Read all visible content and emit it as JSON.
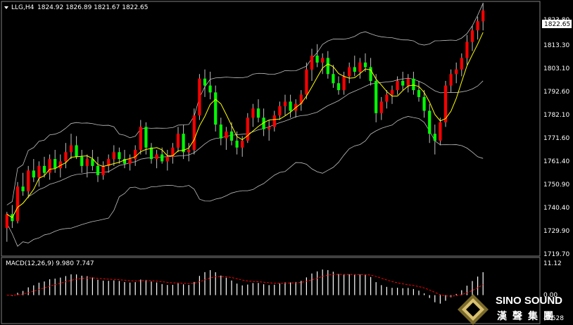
{
  "main_header": {
    "symbol": "LLG,H4",
    "ohlc": "1824.92 1826.89 1821.67 1822.65"
  },
  "macd_header": {
    "label": "MACD(12,26,9) 9.980 7.747"
  },
  "price_axis": {
    "ticks": [
      "1813.30",
      "1803.10",
      "1792.60",
      "1782.10",
      "1771.60",
      "1761.40",
      "1750.90",
      "1740.40",
      "1729.90",
      "1719.70"
    ],
    "current_price": "1822.65",
    "top_partial": "1823.80"
  },
  "macd_axis": {
    "ticks": [
      "11.12",
      "0.00",
      "-8.528"
    ]
  },
  "brand": {
    "name": "SINO SOUND",
    "chinese": "漢聲集團"
  },
  "colors": {
    "up": "#ffffff",
    "down": "#ff0000",
    "up_candle": "#00ff00",
    "ma_fast": "#ffff00",
    "bands": "#bfbfbf",
    "signal": "#ff0000",
    "histogram": "#ffffff"
  },
  "chart_data": {
    "type": "candlestick",
    "ylim": [
      1717,
      1826
    ],
    "candles": [
      [
        1728,
        1735,
        1722,
        1734
      ],
      [
        1734,
        1738,
        1728,
        1731
      ],
      [
        1731,
        1748,
        1730,
        1746
      ],
      [
        1746,
        1752,
        1742,
        1744
      ],
      [
        1744,
        1755,
        1741,
        1753
      ],
      [
        1753,
        1758,
        1748,
        1750
      ],
      [
        1750,
        1757,
        1746,
        1755
      ],
      [
        1755,
        1759,
        1750,
        1752
      ],
      [
        1752,
        1760,
        1749,
        1758
      ],
      [
        1758,
        1762,
        1752,
        1754
      ],
      [
        1754,
        1760,
        1750,
        1757
      ],
      [
        1757,
        1765,
        1754,
        1761
      ],
      [
        1761,
        1769,
        1758,
        1764
      ],
      [
        1764,
        1768,
        1758,
        1759
      ],
      [
        1759,
        1762,
        1752,
        1755
      ],
      [
        1755,
        1760,
        1750,
        1758
      ],
      [
        1758,
        1762,
        1753,
        1755
      ],
      [
        1755,
        1759,
        1748,
        1751
      ],
      [
        1751,
        1757,
        1749,
        1755
      ],
      [
        1755,
        1760,
        1752,
        1758
      ],
      [
        1758,
        1764,
        1755,
        1761
      ],
      [
        1761,
        1763,
        1756,
        1758
      ],
      [
        1758,
        1762,
        1754,
        1756
      ],
      [
        1756,
        1760,
        1753,
        1758
      ],
      [
        1758,
        1764,
        1755,
        1762
      ],
      [
        1762,
        1775,
        1760,
        1772
      ],
      [
        1772,
        1774,
        1760,
        1763
      ],
      [
        1763,
        1765,
        1756,
        1758
      ],
      [
        1758,
        1762,
        1754,
        1760
      ],
      [
        1760,
        1763,
        1756,
        1757
      ],
      [
        1757,
        1762,
        1753,
        1759
      ],
      [
        1759,
        1765,
        1756,
        1763
      ],
      [
        1763,
        1772,
        1761,
        1769
      ],
      [
        1769,
        1773,
        1758,
        1761
      ],
      [
        1761,
        1765,
        1757,
        1762
      ],
      [
        1762,
        1780,
        1760,
        1777
      ],
      [
        1777,
        1795,
        1775,
        1793
      ],
      [
        1793,
        1797,
        1785,
        1790
      ],
      [
        1790,
        1796,
        1784,
        1787
      ],
      [
        1787,
        1790,
        1770,
        1773
      ],
      [
        1773,
        1776,
        1764,
        1767
      ],
      [
        1767,
        1772,
        1762,
        1770
      ],
      [
        1770,
        1774,
        1764,
        1766
      ],
      [
        1766,
        1770,
        1760,
        1763
      ],
      [
        1763,
        1768,
        1759,
        1766
      ],
      [
        1766,
        1778,
        1765,
        1776
      ],
      [
        1776,
        1782,
        1772,
        1780
      ],
      [
        1780,
        1784,
        1774,
        1776
      ],
      [
        1776,
        1780,
        1768,
        1771
      ],
      [
        1771,
        1775,
        1766,
        1772
      ],
      [
        1772,
        1779,
        1770,
        1777
      ],
      [
        1777,
        1783,
        1775,
        1781
      ],
      [
        1781,
        1786,
        1777,
        1783
      ],
      [
        1783,
        1786,
        1776,
        1779
      ],
      [
        1779,
        1784,
        1776,
        1782
      ],
      [
        1782,
        1788,
        1779,
        1786
      ],
      [
        1786,
        1800,
        1784,
        1797
      ],
      [
        1797,
        1806,
        1792,
        1803
      ],
      [
        1803,
        1808,
        1798,
        1800
      ],
      [
        1800,
        1804,
        1795,
        1802
      ],
      [
        1802,
        1805,
        1793,
        1795
      ],
      [
        1795,
        1799,
        1789,
        1791
      ],
      [
        1791,
        1794,
        1786,
        1788
      ],
      [
        1788,
        1796,
        1786,
        1794
      ],
      [
        1794,
        1800,
        1791,
        1798
      ],
      [
        1798,
        1803,
        1794,
        1796
      ],
      [
        1796,
        1802,
        1793,
        1800
      ],
      [
        1800,
        1804,
        1796,
        1798
      ],
      [
        1798,
        1802,
        1790,
        1792
      ],
      [
        1792,
        1795,
        1774,
        1778
      ],
      [
        1778,
        1785,
        1775,
        1783
      ],
      [
        1783,
        1788,
        1780,
        1786
      ],
      [
        1786,
        1790,
        1782,
        1788
      ],
      [
        1788,
        1794,
        1786,
        1792
      ],
      [
        1792,
        1796,
        1788,
        1790
      ],
      [
        1790,
        1795,
        1787,
        1793
      ],
      [
        1793,
        1796,
        1786,
        1788
      ],
      [
        1788,
        1792,
        1783,
        1785
      ],
      [
        1785,
        1788,
        1776,
        1779
      ],
      [
        1779,
        1782,
        1765,
        1769
      ],
      [
        1769,
        1773,
        1760,
        1766
      ],
      [
        1766,
        1776,
        1764,
        1774
      ],
      [
        1774,
        1792,
        1772,
        1790
      ],
      [
        1790,
        1797,
        1787,
        1795
      ],
      [
        1795,
        1800,
        1791,
        1797
      ],
      [
        1797,
        1804,
        1794,
        1802
      ],
      [
        1802,
        1812,
        1799,
        1809
      ],
      [
        1809,
        1816,
        1805,
        1814
      ],
      [
        1814,
        1820,
        1810,
        1818
      ],
      [
        1818,
        1826,
        1814,
        1822.65
      ]
    ]
  }
}
